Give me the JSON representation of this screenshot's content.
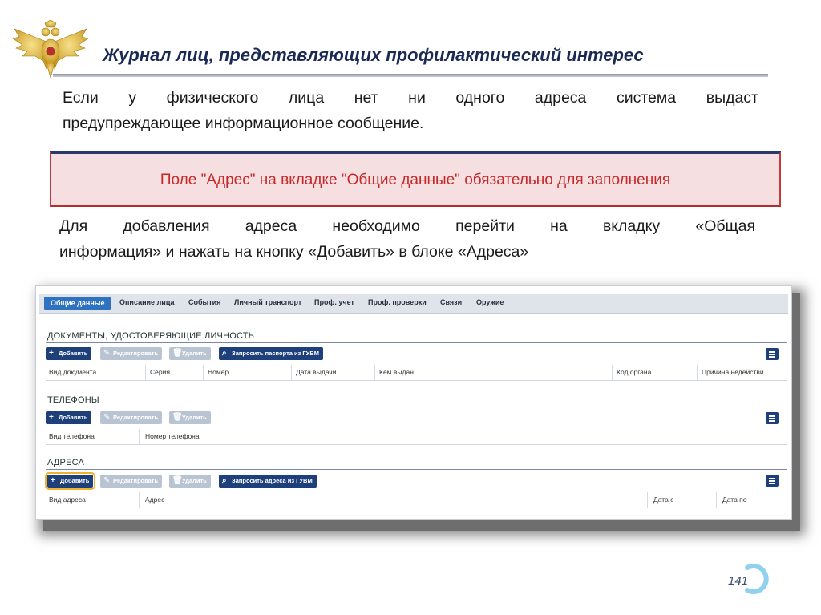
{
  "slide": {
    "title": "Журнал лиц, представляющих профилактический интерес",
    "para1_line1": "Если у физического лица нет ни одного адреса система выдаст",
    "para1_line2": "предупреждающее информационное сообщение.",
    "alert_text": "Поле \"Адрес\" на вкладке \"Общие данные\" обязательно для заполнения",
    "para2_line1": "Для добавления адреса необходимо перейти на вкладку «Общая",
    "para2_line2": "информация» и нажать на кнопку «Добавить» в блоке «Адреса»",
    "page_number": "141"
  },
  "tabs": [
    {
      "label": "Общие данные",
      "active": true
    },
    {
      "label": "Описание лица"
    },
    {
      "label": "События"
    },
    {
      "label": "Личный транспорт"
    },
    {
      "label": "Проф. учет"
    },
    {
      "label": "Проф. проверки"
    },
    {
      "label": "Связи"
    },
    {
      "label": "Оружие"
    }
  ],
  "documents": {
    "title": "ДОКУМЕНТЫ, УДОСТОВЕРЯЮЩИЕ ЛИЧНОСТЬ",
    "add": "Добавить",
    "edit": "Редактировать",
    "delete": "Удалить",
    "request": "Запросить паспорта из ГУВМ",
    "columns": [
      "Вид документа",
      "Серия",
      "Номер",
      "Дата выдачи",
      "Кем выдан",
      "Код органа",
      "Причина недействи..."
    ]
  },
  "phones": {
    "title": "ТЕЛЕФОНЫ",
    "add": "Добавить",
    "edit": "Редактировать",
    "delete": "Удалить",
    "columns": [
      "Вид телефона",
      "Номер телефона"
    ]
  },
  "addresses": {
    "title": "АДРЕСА",
    "add": "Добавить",
    "edit": "Редактировать",
    "delete": "Удалить",
    "request": "Запросить адреса из ГУВМ",
    "columns": [
      "Вид адреса",
      "Адрес",
      "Дата с",
      "Дата по"
    ]
  },
  "colors": {
    "title": "#1b2a55",
    "alert_bg": "#f5dfe1",
    "alert_text": "#c62828",
    "primary_button": "#1d3f7a",
    "active_tab": "#2f72c2",
    "highlight": "#f0b22c"
  },
  "icons": [
    "eagle-emblem-icon",
    "plus-icon",
    "pencil-icon",
    "trash-icon",
    "search-icon",
    "menu-icon",
    "page-arc-icon"
  ]
}
